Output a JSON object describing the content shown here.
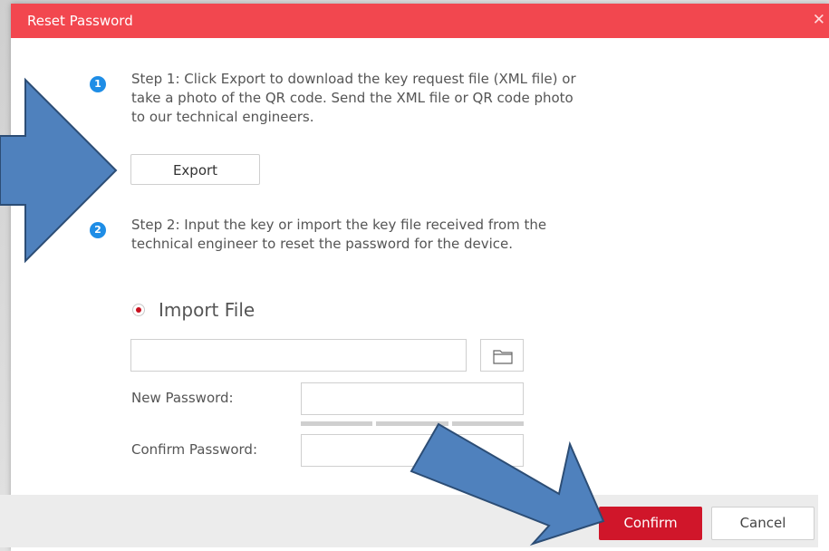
{
  "dialog": {
    "title": "Reset Password",
    "close_icon": "close-icon"
  },
  "step1": {
    "badge": "1",
    "text": "Step 1: Click Export to download the key request file (XML file) or take a photo of the QR code. Send the XML file or QR code photo to our technical engineers.",
    "export_label": "Export"
  },
  "step2": {
    "badge": "2",
    "text": "Step 2: Input the key or import the key file received from the technical engineer to reset the password for the device.",
    "import_option_label": "Import File",
    "import_selected": true,
    "import_file_value": "",
    "folder_icon": "folder-icon"
  },
  "fields": {
    "new_password_label": "New Password:",
    "new_password_value": "",
    "confirm_password_label": "Confirm Password:",
    "confirm_password_value": ""
  },
  "footer": {
    "confirm_label": "Confirm",
    "cancel_label": "Cancel"
  },
  "colors": {
    "titlebar": "#f2474f",
    "step_badge": "#1e8de6",
    "confirm_button": "#d0162a",
    "arrow_fill": "#4f81bd",
    "arrow_stroke": "#2c4d75"
  }
}
